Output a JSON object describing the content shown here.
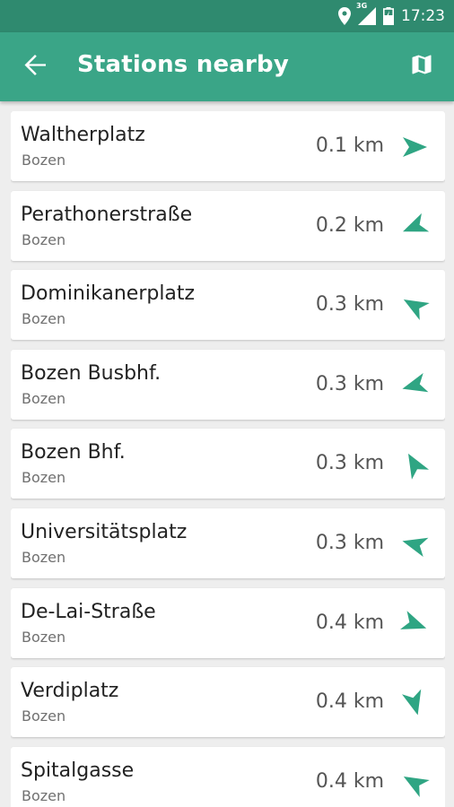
{
  "status_bar": {
    "time": "17:23",
    "network": "3G",
    "icons": [
      "location-icon",
      "signal-icon",
      "battery-icon"
    ]
  },
  "app_bar": {
    "title": "Stations nearby",
    "back_icon": "back-arrow-icon",
    "map_icon": "map-icon"
  },
  "colors": {
    "status_bar": "#2f8a6f",
    "app_bar": "#3aa587",
    "accent": "#2fa583"
  },
  "stations": [
    {
      "name": "Waltherplatz",
      "city": "Bozen",
      "distance": "0.1 km",
      "bearing_deg": 90
    },
    {
      "name": "Perathonerstraße",
      "city": "Bozen",
      "distance": "0.2 km",
      "bearing_deg": 248
    },
    {
      "name": "Dominikanerplatz",
      "city": "Bozen",
      "distance": "0.3 km",
      "bearing_deg": 300
    },
    {
      "name": "Bozen Busbhf.",
      "city": "Bozen",
      "distance": "0.3 km",
      "bearing_deg": 255
    },
    {
      "name": "Bozen Bhf.",
      "city": "Bozen",
      "distance": "0.3 km",
      "bearing_deg": 330
    },
    {
      "name": "Universitätsplatz",
      "city": "Bozen",
      "distance": "0.3 km",
      "bearing_deg": 285
    },
    {
      "name": "De-Lai-Straße",
      "city": "Bozen",
      "distance": "0.4 km",
      "bearing_deg": 110
    },
    {
      "name": "Verdiplatz",
      "city": "Bozen",
      "distance": "0.4 km",
      "bearing_deg": 165
    },
    {
      "name": "Spitalgasse",
      "city": "Bozen",
      "distance": "0.4 km",
      "bearing_deg": 300
    }
  ]
}
